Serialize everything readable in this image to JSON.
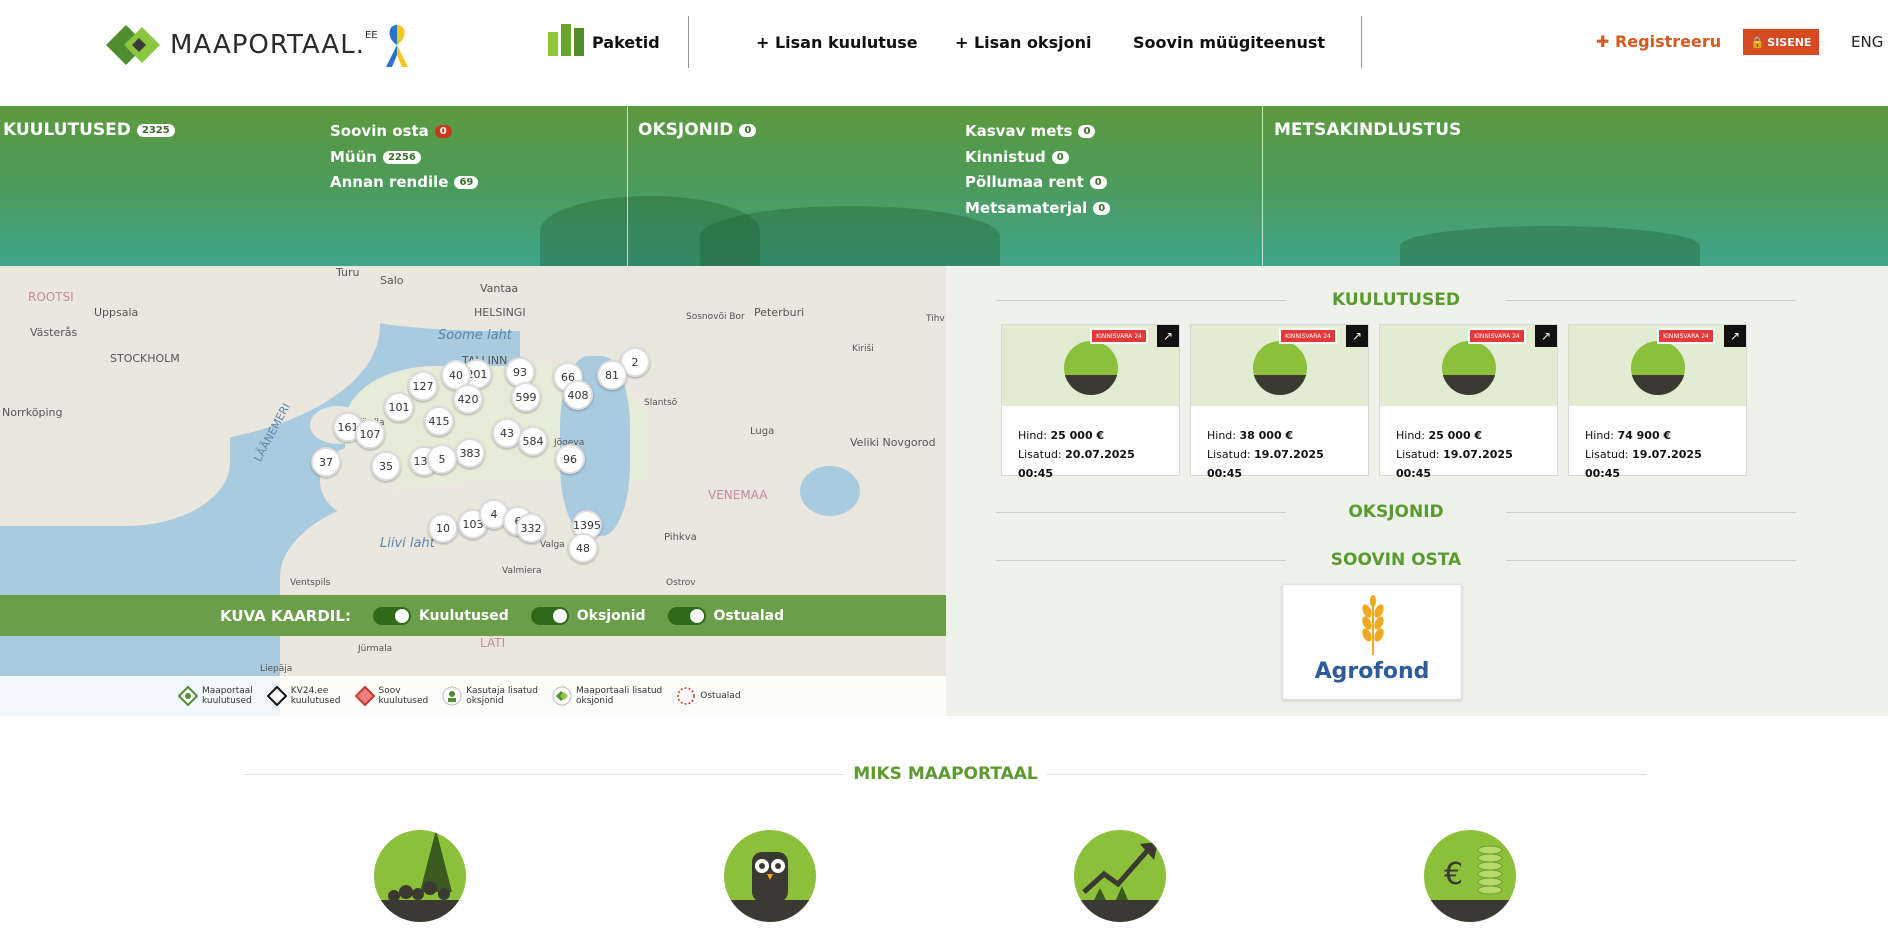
{
  "header": {
    "logo_text": "MAAPORTAAL.",
    "logo_suffix": "EE",
    "nav": [
      "Paketid",
      "+ Lisan kuulutuse",
      "+ Lisan oksjoni",
      "Soovin müügiteenust"
    ],
    "register": "Registreeru",
    "login": "SISENE",
    "lang": "ENG"
  },
  "band": {
    "kuulutused": {
      "title": "KUULUTUSED",
      "count": "2325",
      "items": [
        {
          "label": "Soovin osta",
          "count": "0"
        },
        {
          "label": "Müün",
          "count": "2256"
        },
        {
          "label": "Annan rendile",
          "count": "69"
        }
      ]
    },
    "oksjonid": {
      "title": "OKSJONID",
      "count": "0",
      "items": [
        {
          "label": "Kasvav mets",
          "count": "0"
        },
        {
          "label": "Kinnistud",
          "count": "0"
        },
        {
          "label": "Põllumaa rent",
          "count": "0"
        },
        {
          "label": "Metsamaterjal",
          "count": "0"
        }
      ]
    },
    "metsakindlustus": {
      "title": "METSAKINDLUSTUS"
    }
  },
  "map": {
    "labels": [
      "ROOTSI",
      "Uppsala",
      "Västerås",
      "STOCKHOLM",
      "Norrköping",
      "LÄÄNEMERI",
      "Soome laht",
      "HELSINGI",
      "Vantaa",
      "Turu",
      "Salo",
      "TALLINN",
      "Sosnovõi Bor",
      "Peterburi",
      "Tihv",
      "Kiriši",
      "Slantsõ",
      "Luga",
      "Veliki Novgorod",
      "VENEMAA",
      "Pihkva",
      "Ostrov",
      "Valmiera",
      "Ventspils",
      "Liivi laht",
      "LÄTI",
      "Jürmala",
      "Liepāja",
      "Jõgeva",
      "Valga",
      "Kärdla"
    ],
    "clusters": [
      "2",
      "81",
      "66",
      "408",
      "93",
      "201",
      "40",
      "127",
      "599",
      "420",
      "101",
      "415",
      "161",
      "107",
      "43",
      "584",
      "383",
      "96",
      "37",
      "35",
      "138",
      "5",
      "10",
      "103",
      "4",
      "6",
      "332",
      "1395",
      "48"
    ],
    "toggle_title": "KUVA KAARDIL:",
    "toggles": [
      "Kuulutused",
      "Oksjonid",
      "Ostualad"
    ],
    "legend": [
      {
        "l1": "Maaportaal",
        "l2": "kuulutused"
      },
      {
        "l1": "KV24.ee",
        "l2": "kuulutused"
      },
      {
        "l1": "Soov",
        "l2": "kuulutused"
      },
      {
        "l1": "Kasutaja lisatud",
        "l2": "oksjonid"
      },
      {
        "l1": "Maaportaali lisatud",
        "l2": "oksjonid"
      },
      {
        "l1": "Ostualad",
        "l2": ""
      }
    ]
  },
  "right": {
    "kuulutused_title": "KUULUTUSED",
    "cards": [
      {
        "badge": "KINNISVARA 24",
        "price_label": "Hind:",
        "price": "25 000 €",
        "added_label": "Lisatud:",
        "added": "20.07.2025 00:45"
      },
      {
        "badge": "KINNISVARA 24",
        "price_label": "Hind:",
        "price": "38 000 €",
        "added_label": "Lisatud:",
        "added": "19.07.2025 00:45"
      },
      {
        "badge": "KINNISVARA 24",
        "price_label": "Hind:",
        "price": "25 000 €",
        "added_label": "Lisatud:",
        "added": "19.07.2025 00:45"
      },
      {
        "badge": "KINNISVARA 24",
        "price_label": "Hind:",
        "price": "74 900 €",
        "added_label": "Lisatud:",
        "added": "19.07.2025 00:45"
      }
    ],
    "oksjonid_title": "OKSJONID",
    "soovin_title": "SOOVIN OSTA",
    "agrofond": "Agrofond"
  },
  "miks": {
    "title": "MIKS MAAPORTAAL"
  },
  "colors": {
    "green": "#5a9a2e",
    "orange": "#d64a1f",
    "leaf": "#8dc03a"
  }
}
